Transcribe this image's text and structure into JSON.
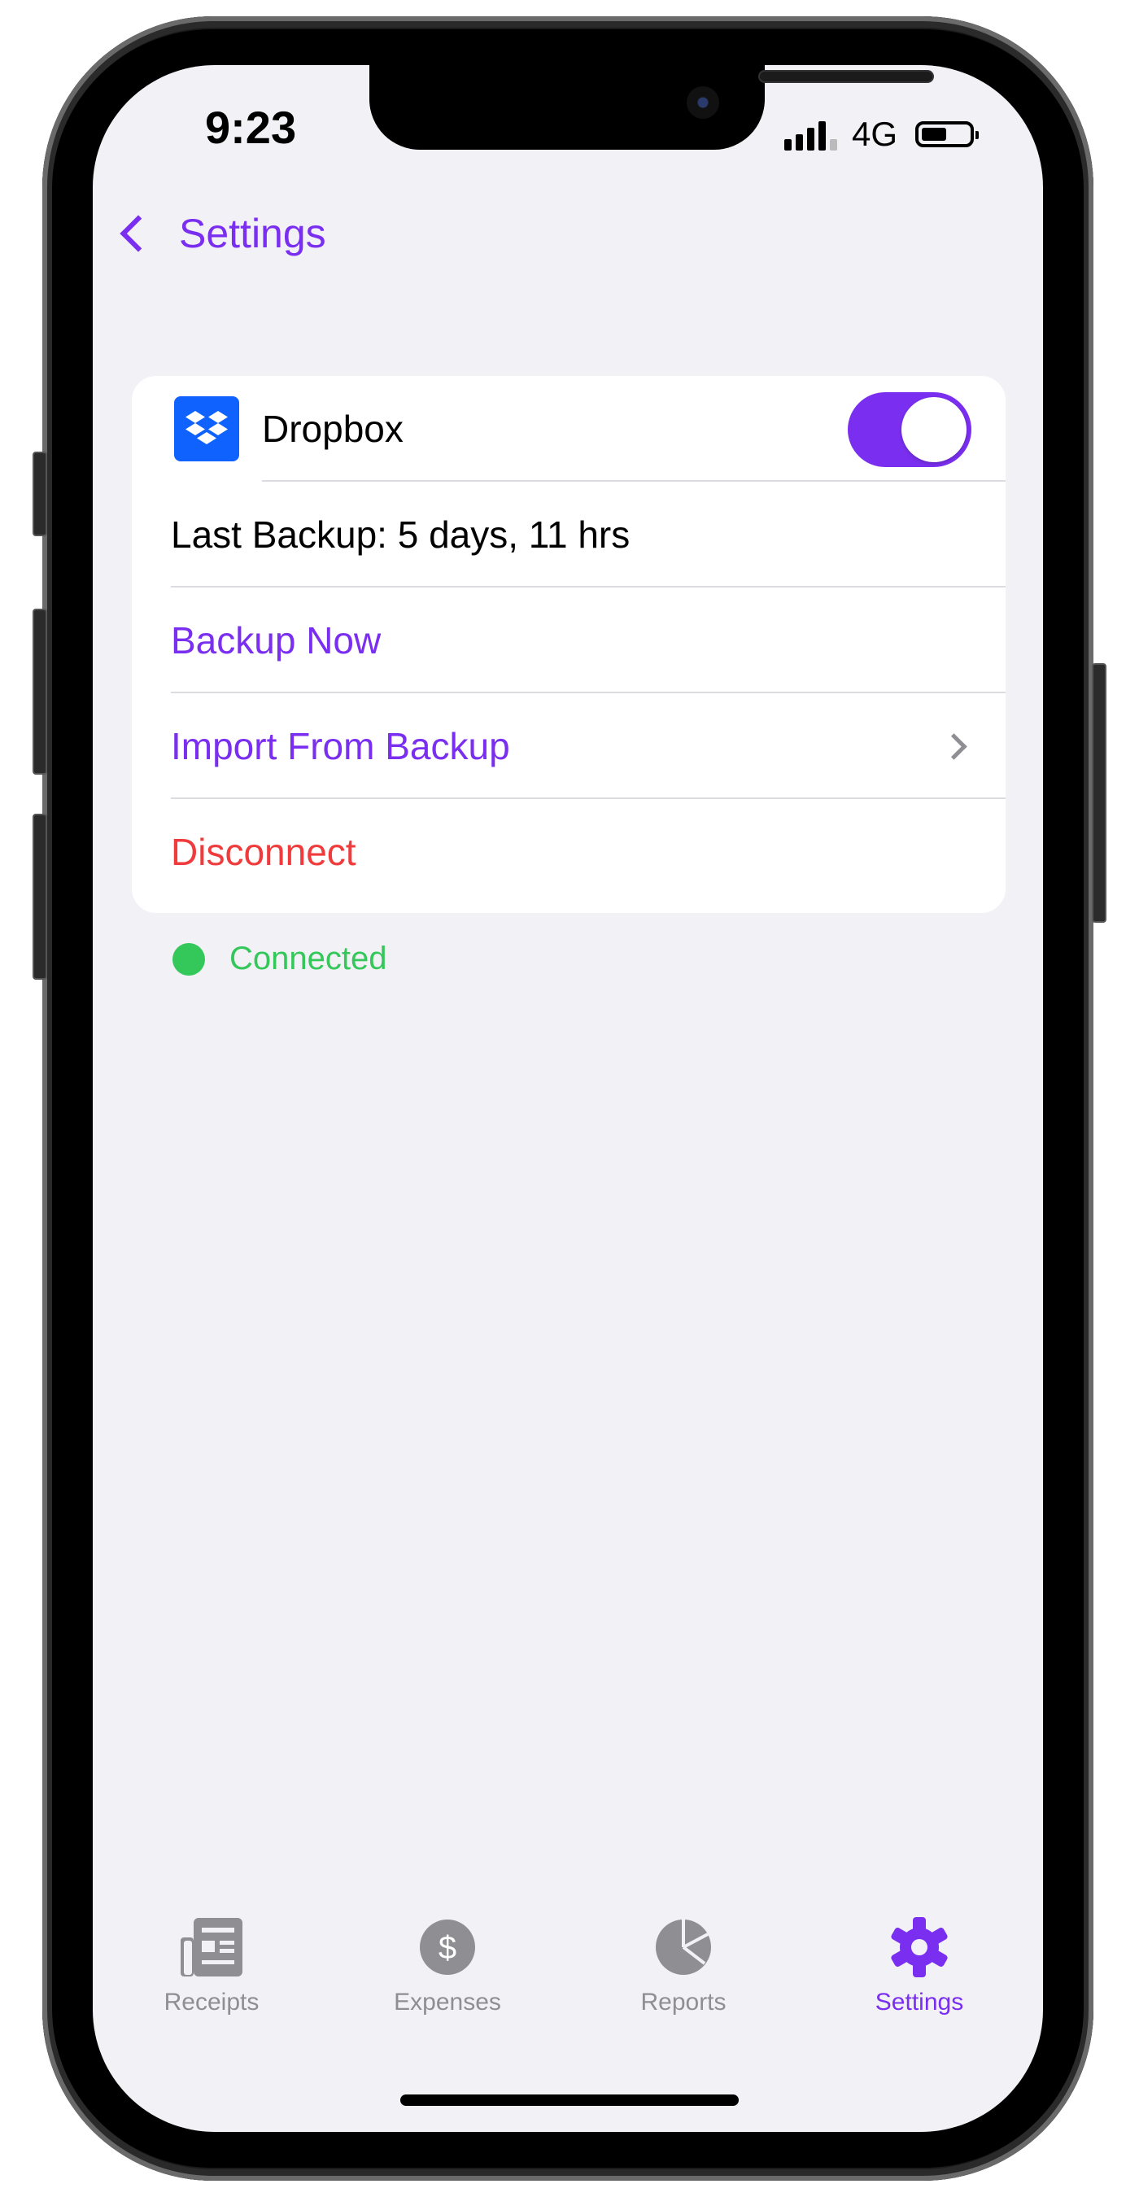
{
  "status_bar": {
    "time": "9:23",
    "network": "4G",
    "icons": [
      "signal-icon",
      "battery-icon"
    ]
  },
  "nav": {
    "back_label": "Settings",
    "back_icon": "chevron-left-icon"
  },
  "dropbox": {
    "title": "Dropbox",
    "icon": "dropbox-icon",
    "enabled": true,
    "last_backup": "Last Backup: 5 days, 11 hrs",
    "backup_now": "Backup Now",
    "import_backup": "Import From Backup",
    "disconnect": "Disconnect",
    "connection_status": "Connected"
  },
  "tabs": [
    {
      "label": "Receipts",
      "icon": "receipt-icon",
      "active": false
    },
    {
      "label": "Expenses",
      "icon": "dollar-circle-icon",
      "active": false
    },
    {
      "label": "Reports",
      "icon": "pie-chart-icon",
      "active": false
    },
    {
      "label": "Settings",
      "icon": "gear-icon",
      "active": true
    }
  ],
  "colors": {
    "accent": "#7a2ff0",
    "destructive": "#ef3b3b",
    "success": "#34c759",
    "background": "#f2f1f6",
    "inactive": "#8e8e93",
    "dropbox_blue": "#0f62fe"
  }
}
